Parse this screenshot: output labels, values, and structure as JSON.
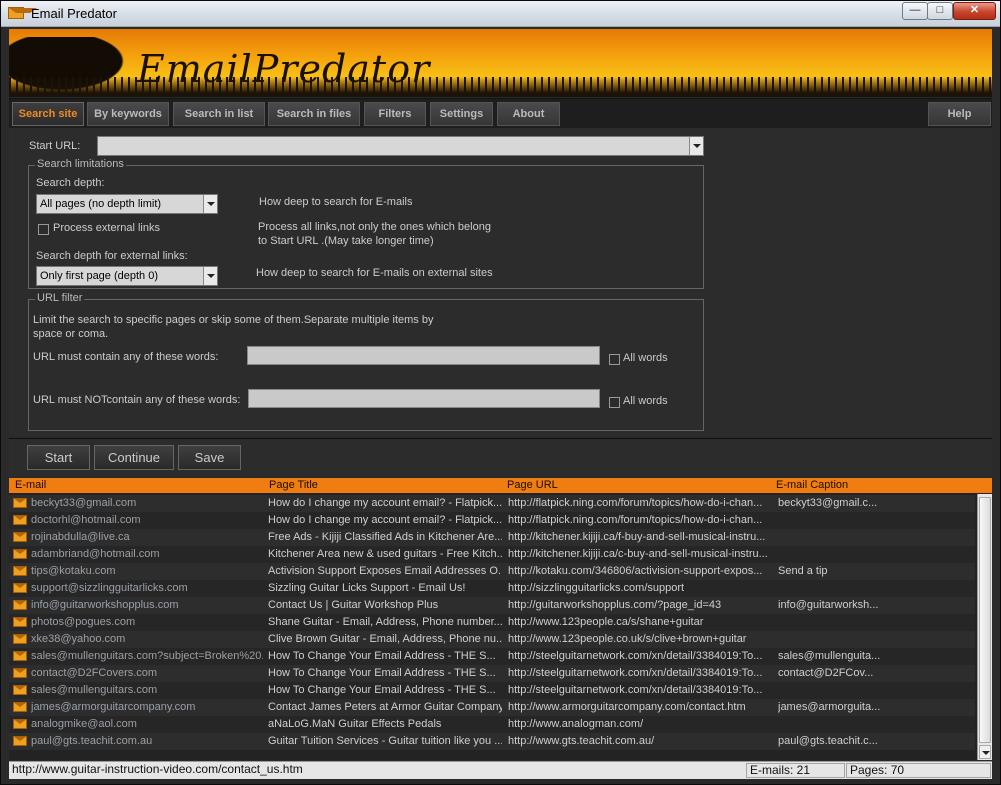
{
  "window": {
    "title": "Email Predator"
  },
  "banner": {
    "logo_text": "EmailPredator"
  },
  "tabs": [
    {
      "label": "Search site",
      "active": true
    },
    {
      "label": "By keywords"
    },
    {
      "label": "Search in list"
    },
    {
      "label": "Search in files"
    },
    {
      "label": "Filters"
    },
    {
      "label": "Settings"
    },
    {
      "label": "About"
    },
    {
      "label": "Help"
    }
  ],
  "settings": {
    "start_url_label": "Start URL:",
    "start_url_value": "",
    "search_limitations": {
      "legend": "Search limitations",
      "depth_label": "Search depth:",
      "depth_value": "All pages (no depth limit)",
      "depth_hint": "How deep to search for E-mails",
      "external_links_label": "Process external links",
      "external_links_checked": false,
      "external_hint_1": "Process all links,not only the ones which belong",
      "external_hint_2": "to Start URL .(May take longer time)",
      "ext_depth_label": "Search depth for external links:",
      "ext_depth_value": "Only first page (depth 0)",
      "ext_depth_hint": "How deep to search for E-mails on external sites"
    },
    "url_filter": {
      "legend": "URL filter",
      "desc_1": "Limit the search to specific pages or skip some of them.Separate multiple items by",
      "desc_2": "space or coma.",
      "must_contain_label": "URL must contain any of these words:",
      "must_contain_value": "",
      "must_not_label": "URL must NOTcontain any of these words:",
      "must_not_value": "",
      "all_words_label": "All words"
    }
  },
  "actions": {
    "start": "Start",
    "continue": "Continue",
    "save": "Save"
  },
  "results": {
    "columns": {
      "email": "E-mail",
      "title": "Page Title",
      "url": "Page URL",
      "caption": "E-mail Caption"
    },
    "rows": [
      {
        "email": "beckyt33@gmail.com",
        "title": "How do I change my account email? - Flatpick...",
        "url": "http://flatpick.ning.com/forum/topics/how-do-i-chan...",
        "caption": "beckyt33@gmail.c..."
      },
      {
        "email": "doctorhl@hotmail.com",
        "title": "How do I change my account email? - Flatpick...",
        "url": "http://flatpick.ning.com/forum/topics/how-do-i-chan...",
        "caption": ""
      },
      {
        "email": "rojinabdulla@live.ca",
        "title": "Free Ads - Kijiji Classified Ads in Kitchener Are...",
        "url": "http://kitchener.kijiji.ca/f-buy-and-sell-musical-instru...",
        "caption": ""
      },
      {
        "email": "adambriand@hotmail.com",
        "title": "Kitchener Area new & used guitars - Free Kitch...",
        "url": "http://kitchener.kijiji.ca/c-buy-and-sell-musical-instru...",
        "caption": ""
      },
      {
        "email": "tips@kotaku.com",
        "title": "Activision Support Exposes Email Addresses O...",
        "url": "http://kotaku.com/346806/activision-support-expos...",
        "caption": "Send a tip"
      },
      {
        "email": "support@sizzlingguitarlicks.com",
        "title": "Sizzling Guitar Licks Support - Email Us!",
        "url": "http://sizzlingguitarlicks.com/support",
        "caption": ""
      },
      {
        "email": "info@guitarworkshopplus.com",
        "title": "Contact Us | Guitar Workshop Plus",
        "url": "http://guitarworkshopplus.com/?page_id=43",
        "caption": "info@guitarworksh..."
      },
      {
        "email": "photos@pogues.com",
        "title": "Shane Guitar - Email, Address, Phone number...",
        "url": "http://www.123people.ca/s/shane+guitar",
        "caption": ""
      },
      {
        "email": "xke38@yahoo.com",
        "title": "Clive Brown Guitar - Email, Address, Phone nu...",
        "url": "http://www.123people.co.uk/s/clive+brown+guitar",
        "caption": ""
      },
      {
        "email": "sales@mullenguitars.com?subject=Broken%20...",
        "title": "How To Change Your Email Address - THE S...",
        "url": "http://steelguitarnetwork.com/xn/detail/3384019:To...",
        "caption": "sales@mullenguita..."
      },
      {
        "email": "contact@D2FCovers.com",
        "title": "How To Change Your Email Address - THE S...",
        "url": "http://steelguitarnetwork.com/xn/detail/3384019:To...",
        "caption": "contact@D2FCov..."
      },
      {
        "email": "sales@mullenguitars.com",
        "title": "How To Change Your Email Address - THE S...",
        "url": "http://steelguitarnetwork.com/xn/detail/3384019:To...",
        "caption": ""
      },
      {
        "email": "james@armorguitarcompany.com",
        "title": "Contact James Peters at Armor Guitar Company",
        "url": "http://www.armorguitarcompany.com/contact.htm",
        "caption": "james@armorguita..."
      },
      {
        "email": "analogmike@aol.com",
        "title": "aNaLoG.MaN Guitar Effects Pedals",
        "url": "http://www.analogman.com/",
        "caption": ""
      },
      {
        "email": "paul@gts.teachit.com.au",
        "title": "Guitar Tuition Services - Guitar tuition like you ...",
        "url": "http://www.gts.teachit.com.au/",
        "caption": "paul@gts.teachit.c..."
      }
    ]
  },
  "status": {
    "current_url": "http://www.guitar-instruction-video.com/contact_us.htm",
    "emails": "E-mails: 21",
    "pages": "Pages: 70"
  }
}
